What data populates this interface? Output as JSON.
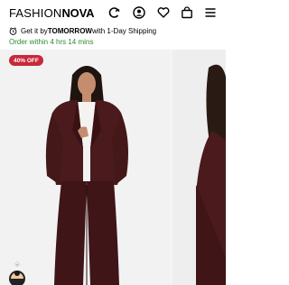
{
  "header": {
    "logo_left": "FASHION",
    "logo_right": "NOVA",
    "icons": [
      "sparkle-cart-icon",
      "account-icon",
      "heart-icon",
      "bag-icon",
      "menu-icon"
    ]
  },
  "shipping": {
    "prefix": "Get it by ",
    "day": "TOMORROW",
    "suffix": " with 1-Day Shipping",
    "order_window": "Order within 4 hrs 14 mins"
  },
  "gallery": {
    "badge": "40% OFF"
  },
  "colors": {
    "badge": "#c8293a",
    "order_window": "#2e8b2e",
    "suit": "#4a1a1c"
  }
}
